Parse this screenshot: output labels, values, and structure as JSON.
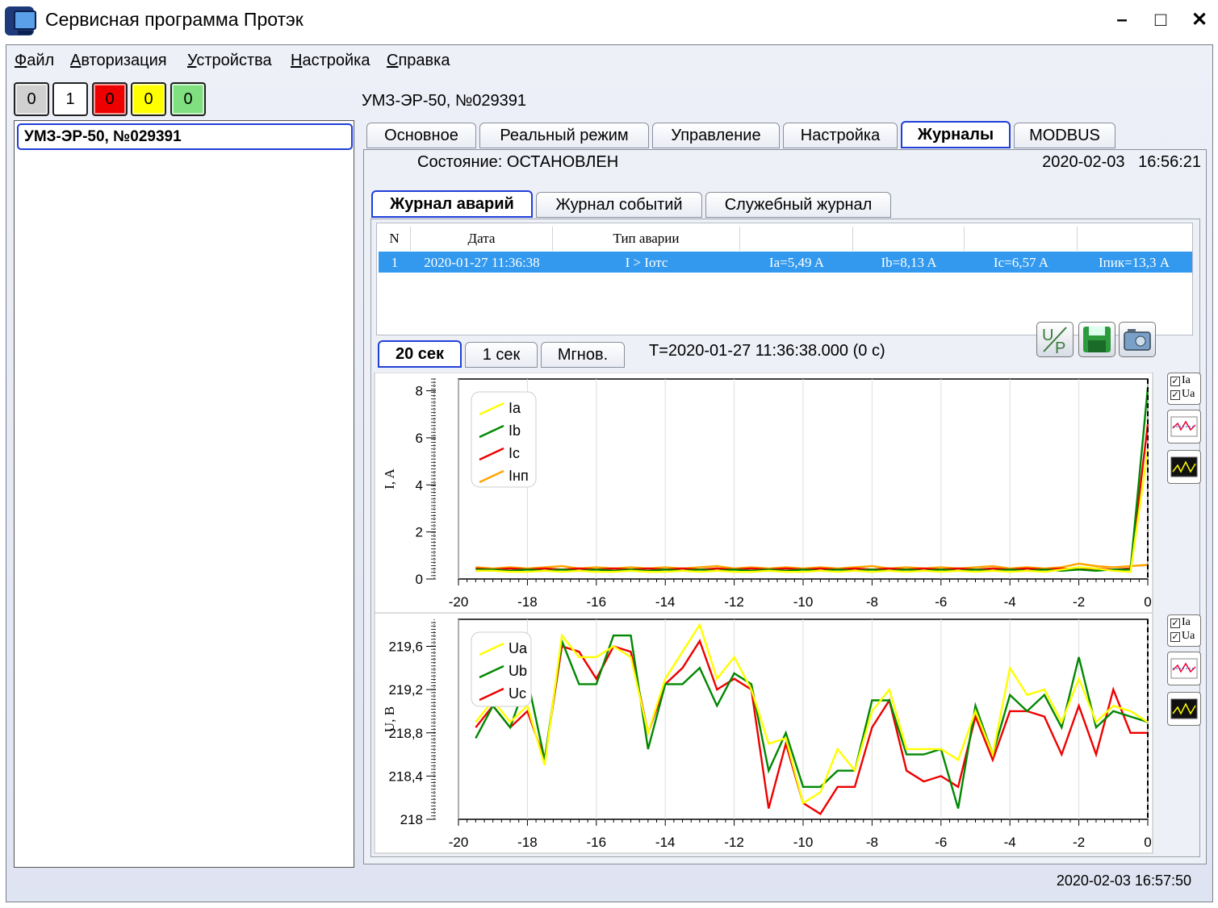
{
  "window": {
    "title": "Сервисная программа Протэк",
    "minimize": "–",
    "maximize": "□",
    "close": "✕"
  },
  "menu": [
    "Файл",
    "Авторизация",
    "Устройства",
    "Настройка",
    "Справка"
  ],
  "counters": [
    {
      "value": "0",
      "color": "#d0d0d0"
    },
    {
      "value": "1",
      "color": "#ffffff"
    },
    {
      "value": "0",
      "color": "#ee0000"
    },
    {
      "value": "0",
      "color": "#ffff00"
    },
    {
      "value": "0",
      "color": "#80e080"
    }
  ],
  "tree": {
    "item": "УМЗ-ЭР-50, №029391"
  },
  "device_header": "УМЗ-ЭР-50, №029391",
  "tabs": [
    "Основное",
    "Реальный режим",
    "Управление",
    "Настройка",
    "Журналы",
    "MODBUS"
  ],
  "active_tab": "Журналы",
  "state": "Состояние: ОСТАНОВЛЕН",
  "datetime": "2020-02-03   16:56:21",
  "journal_tabs": [
    "Журнал аварий",
    "Журнал событий",
    "Служебный журнал"
  ],
  "journal_table": {
    "headers": [
      "N",
      "Дата",
      "Тип аварии",
      "",
      "",
      "",
      ""
    ],
    "rows": [
      [
        "1",
        "2020-01-27 11:36:38",
        "I > Iотс",
        "Ia=5,49 A",
        "Ib=8,13 A",
        "Ic=6,57 A",
        "Iпик=13,3 A"
      ]
    ]
  },
  "time_tabs": [
    "20 сек",
    "1 сек",
    "Мгнов."
  ],
  "time_label": "T=2020-01-27 11:36:38.000 (0 с)",
  "side_checks": [
    "Ia",
    "Ua"
  ],
  "icons": {
    "up": "u-over-p-icon",
    "save": "floppy-disk-icon",
    "camera": "camera-icon",
    "scale1": "waveform-zoom-icon",
    "scale2": "oscilloscope-icon"
  },
  "colors": {
    "a": "#ffff00",
    "b": "#008800",
    "c": "#ee0000",
    "n": "#ffa500",
    "accent": "#1f3fd8",
    "selection": "#3399ee"
  },
  "status_time": "2020-02-03 16:57:50",
  "chart_data": [
    {
      "type": "line",
      "ylabel": "I, A",
      "xlim": [
        -20,
        0
      ],
      "ylim": [
        0,
        8.5
      ],
      "xticks": [
        "-20",
        "-18",
        "-16",
        "-14",
        "-12",
        "-10",
        "-8",
        "-6",
        "-4",
        "-2",
        "0"
      ],
      "yticks": [
        {
          "v": 0,
          "label": "0"
        },
        {
          "v": 2,
          "label": "2"
        },
        {
          "v": 4,
          "label": "4"
        },
        {
          "v": 6,
          "label": "6"
        },
        {
          "v": 8,
          "label": "8"
        }
      ],
      "x": [
        -19.5,
        -19,
        -18.5,
        -18,
        -17.5,
        -17,
        -16.5,
        -16,
        -15.5,
        -15,
        -14.5,
        -14,
        -13.5,
        -13,
        -12.5,
        -12,
        -11.5,
        -11,
        -10.5,
        -10,
        -9.5,
        -9,
        -8.5,
        -8,
        -7.5,
        -7,
        -6.5,
        -6,
        -5.5,
        -5,
        -4.5,
        -4,
        -3.5,
        -3,
        -2.5,
        -2,
        -1.5,
        -1,
        -0.5,
        0
      ],
      "series": [
        {
          "name": "Ia",
          "color": "#ffff00",
          "values": [
            0.35,
            0.35,
            0.3,
            0.3,
            0.35,
            0.3,
            0.35,
            0.3,
            0.3,
            0.35,
            0.3,
            0.3,
            0.35,
            0.3,
            0.35,
            0.3,
            0.3,
            0.35,
            0.3,
            0.3,
            0.35,
            0.3,
            0.35,
            0.3,
            0.35,
            0.3,
            0.35,
            0.3,
            0.35,
            0.3,
            0.35,
            0.3,
            0.35,
            0.3,
            0.4,
            0.5,
            0.45,
            0.35,
            0.3,
            5.49
          ]
        },
        {
          "name": "Ib",
          "color": "#008800",
          "values": [
            0.4,
            0.4,
            0.35,
            0.4,
            0.35,
            0.4,
            0.35,
            0.4,
            0.35,
            0.4,
            0.35,
            0.4,
            0.35,
            0.4,
            0.35,
            0.4,
            0.35,
            0.4,
            0.35,
            0.4,
            0.35,
            0.4,
            0.35,
            0.4,
            0.35,
            0.4,
            0.35,
            0.4,
            0.35,
            0.4,
            0.35,
            0.4,
            0.35,
            0.4,
            0.35,
            0.4,
            0.35,
            0.4,
            0.4,
            8.13
          ]
        },
        {
          "name": "Ic",
          "color": "#ee0000",
          "values": [
            0.45,
            0.4,
            0.45,
            0.4,
            0.45,
            0.4,
            0.45,
            0.4,
            0.45,
            0.4,
            0.45,
            0.4,
            0.45,
            0.4,
            0.45,
            0.4,
            0.45,
            0.4,
            0.45,
            0.4,
            0.45,
            0.4,
            0.45,
            0.4,
            0.45,
            0.4,
            0.45,
            0.4,
            0.45,
            0.4,
            0.45,
            0.4,
            0.45,
            0.4,
            0.45,
            0.4,
            0.45,
            0.4,
            0.45,
            6.57
          ]
        },
        {
          "name": "Iнп",
          "color": "#ffa500",
          "values": [
            0.5,
            0.45,
            0.5,
            0.45,
            0.5,
            0.55,
            0.45,
            0.5,
            0.45,
            0.5,
            0.45,
            0.5,
            0.45,
            0.5,
            0.55,
            0.45,
            0.5,
            0.45,
            0.5,
            0.45,
            0.5,
            0.45,
            0.5,
            0.55,
            0.45,
            0.5,
            0.45,
            0.5,
            0.45,
            0.5,
            0.55,
            0.45,
            0.5,
            0.45,
            0.5,
            0.65,
            0.55,
            0.5,
            0.55,
            0.6
          ]
        }
      ]
    },
    {
      "type": "line",
      "ylabel": "U, В",
      "xlim": [
        -20,
        0
      ],
      "ylim": [
        218,
        219.85
      ],
      "xticks": [
        "-20",
        "-18",
        "-16",
        "-14",
        "-12",
        "-10",
        "-8",
        "-6",
        "-4",
        "-2",
        "0"
      ],
      "yticks": [
        {
          "v": 218,
          "label": "218"
        },
        {
          "v": 218.4,
          "label": "218,4"
        },
        {
          "v": 218.8,
          "label": "218,8"
        },
        {
          "v": 219.2,
          "label": "219,2"
        },
        {
          "v": 219.6,
          "label": "219,6"
        }
      ],
      "x": [
        -19.5,
        -19,
        -18.5,
        -18,
        -17.5,
        -17,
        -16.5,
        -16,
        -15.5,
        -15,
        -14.5,
        -14,
        -13.5,
        -13,
        -12.5,
        -12,
        -11.5,
        -11,
        -10.5,
        -10,
        -9.5,
        -9,
        -8.5,
        -8,
        -7.5,
        -7,
        -6.5,
        -6,
        -5.5,
        -5,
        -4.5,
        -4,
        -3.5,
        -3,
        -2.5,
        -2,
        -1.5,
        -1,
        -0.5,
        0
      ],
      "series": [
        {
          "name": "Ua",
          "color": "#ffff00",
          "values": [
            218.9,
            219.1,
            218.9,
            219.05,
            218.5,
            219.7,
            219.5,
            219.5,
            219.6,
            219.5,
            218.8,
            219.3,
            219.55,
            219.8,
            219.3,
            219.5,
            219.2,
            218.7,
            218.75,
            218.15,
            218.25,
            218.65,
            218.45,
            219.0,
            219.2,
            218.65,
            218.65,
            218.65,
            218.55,
            219.0,
            218.6,
            219.4,
            219.15,
            219.2,
            218.9,
            219.3,
            218.9,
            219.05,
            219.0,
            218.9
          ]
        },
        {
          "name": "Ub",
          "color": "#008800",
          "values": [
            218.75,
            219.05,
            218.85,
            219.3,
            218.55,
            219.65,
            219.25,
            219.25,
            219.7,
            219.7,
            218.65,
            219.25,
            219.25,
            219.4,
            219.05,
            219.35,
            219.25,
            218.45,
            218.8,
            218.3,
            218.3,
            218.45,
            218.45,
            219.1,
            219.1,
            218.6,
            218.6,
            218.65,
            218.1,
            219.05,
            218.6,
            219.15,
            219.0,
            219.15,
            218.85,
            219.5,
            218.85,
            219.0,
            218.95,
            218.9
          ]
        },
        {
          "name": "Uc",
          "color": "#ee0000",
          "values": [
            218.85,
            219.05,
            218.85,
            219.0,
            218.55,
            219.6,
            219.55,
            219.3,
            219.6,
            219.55,
            218.8,
            219.25,
            219.4,
            219.65,
            219.2,
            219.3,
            219.2,
            218.1,
            218.7,
            218.15,
            218.05,
            218.3,
            218.3,
            218.85,
            219.1,
            218.45,
            218.35,
            218.4,
            218.3,
            218.95,
            218.55,
            219.0,
            219.0,
            218.95,
            218.6,
            219.05,
            218.6,
            219.2,
            218.8,
            218.8
          ]
        }
      ]
    }
  ]
}
